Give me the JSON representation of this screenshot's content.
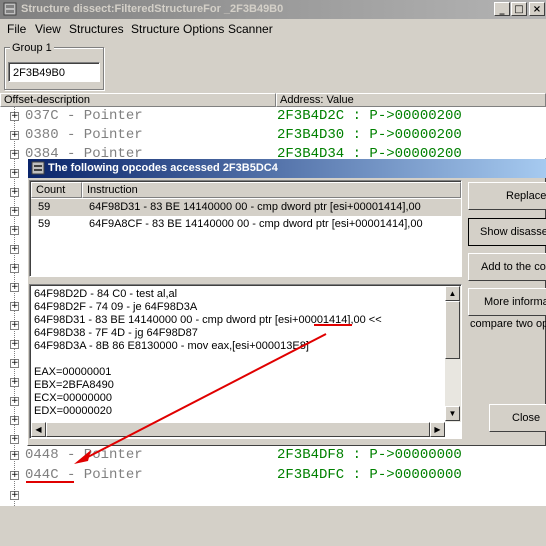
{
  "main_window": {
    "title": "Structure dissect:FilteredStructureFor _2F3B49B0",
    "controls": {
      "minimize": "_",
      "maximize": "□",
      "close": "×"
    }
  },
  "menu": [
    "File",
    "View",
    "Structures",
    "Structure Options",
    "Scanner"
  ],
  "group": {
    "label": "Group 1",
    "address_value": "2F3B49B0"
  },
  "columns": {
    "offset": "Offset-description",
    "address": "Address: Value"
  },
  "rows": [
    {
      "offset": "037C - Pointer",
      "address": "2F3B4D2C : P->00000200"
    },
    {
      "offset": "0380 - Pointer",
      "address": "2F3B4D30 : P->00000200"
    },
    {
      "offset": "0384 - Pointer",
      "address": "2F3B4D34 : P->00000200"
    },
    {
      "offset": "0448 - Pointer",
      "address": "2F3B4DF8 : P->00000000"
    },
    {
      "offset": "044C - Pointer",
      "address": "2F3B4DFC : P->00000000"
    }
  ],
  "dialog": {
    "title": "The following opcodes accessed 2F3B5DC4",
    "list_headers": {
      "count": "Count",
      "instruction": "Instruction"
    },
    "list_rows": [
      {
        "count": "59",
        "instruction": "64F98D31 - 83 BE 14140000 00 - cmp dword ptr [esi+00001414],00"
      },
      {
        "count": "59",
        "instruction": "64F9A8CF - 83 BE 14140000 00 - cmp dword ptr [esi+00001414],00"
      }
    ],
    "detail_lines": [
      "64F98D2D - 84 C0  - test al,al",
      "64F98D2F - 74 09 - je 64F98D3A",
      "64F98D31 - 83 BE 14140000 00 - cmp dword ptr [esi+00001414],00 <<",
      "64F98D38 - 7F 4D - jg 64F98D87",
      "64F98D3A - 8B 86 E8130000  - mov eax,[esi+000013E8]",
      "",
      "EAX=00000001",
      "EBX=2BFA8490",
      "ECX=00000000",
      "EDX=00000020"
    ],
    "buttons": {
      "replace": "Replace",
      "show_disassembler": "Show disasse",
      "add_to_codelist": "Add to the co",
      "more_info": "More informa",
      "close": "Close"
    },
    "compare_text": "compare two op"
  },
  "colors": {
    "offset_text": "#808080",
    "address_text": "#008000",
    "annotation": "#e00000",
    "dialog_title": "#0a246a"
  }
}
